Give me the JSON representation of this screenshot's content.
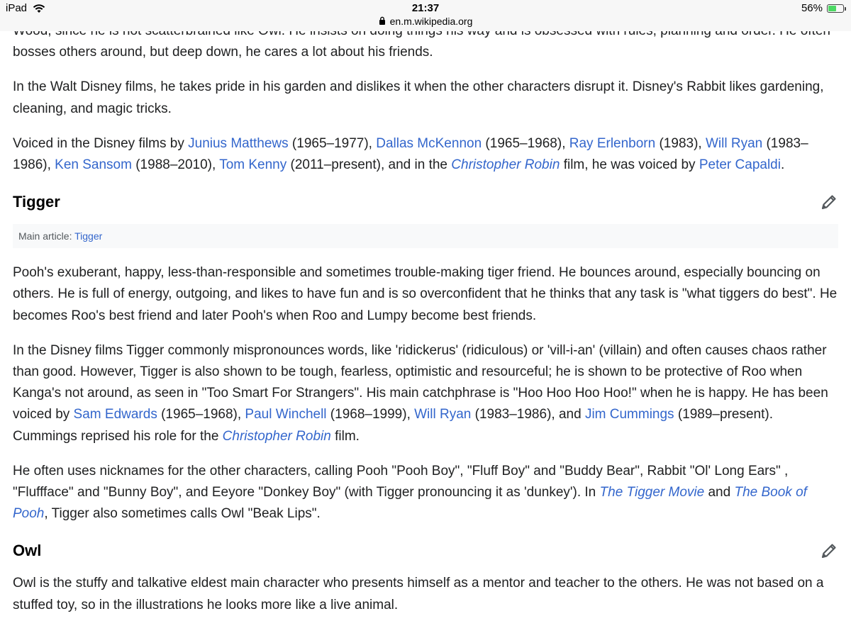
{
  "status_bar": {
    "device": "iPad",
    "time": "21:37",
    "url": "en.m.wikipedia.org",
    "battery_text": "56%",
    "battery_level": 0.56
  },
  "rabbit": {
    "p1_cut": "Wood, since he is not scatterbrained like Owl. He insists on doing things his way and is obsessed with rules, planning and order. He often",
    "p1": "bosses others around, but deep down, he cares a lot about his friends.",
    "p2": "In the Walt Disney films, he takes pride in his garden and dislikes it when the other characters disrupt it. Disney's Rabbit likes gardening, cleaning, and magic tricks.",
    "p3": {
      "t1": "Voiced in the Disney films by ",
      "l1": "Junius Matthews",
      "t2": " (1965–1977), ",
      "l2": "Dallas McKennon",
      "t3": " (1965–1968), ",
      "l3": "Ray Erlenborn",
      "t4": " (1983), ",
      "l4": "Will Ryan",
      "t5": " (1983–1986), ",
      "l5": "Ken Sansom",
      "t6": " (1988–2010), ",
      "l6": "Tom Kenny",
      "t7": " (2011–present), and in the ",
      "l7": "Christopher Robin",
      "t8": " film, he was voiced by ",
      "l8": "Peter Capaldi",
      "t9": "."
    }
  },
  "tigger": {
    "heading": "Tigger",
    "hatnote_label": "Main article: ",
    "hatnote_link": "Tigger",
    "p1": "Pooh's exuberant, happy, less-than-responsible and sometimes trouble-making tiger friend. He bounces around, especially bouncing on others. He is full of energy, outgoing, and likes to have fun and is so overconfident that he thinks that any task is \"what tiggers do best\". He becomes Roo's best friend and later Pooh's when Roo and Lumpy become best friends.",
    "p2": {
      "t1": "In the Disney films Tigger commonly mispronounces words, like 'ridickerus' (ridiculous) or 'vill-i-an' (villain) and often causes chaos rather than good. However, Tigger is also shown to be tough, fearless, optimistic and resourceful; he is shown to be protective of Roo when Kanga's not around, as seen in \"Too Smart For Strangers\". His main catchphrase is \"Hoo Hoo Hoo Hoo!\" when he is happy. He has been voiced by ",
      "l1": "Sam Edwards",
      "t2": " (1965–1968), ",
      "l2": "Paul Winchell",
      "t3": " (1968–1999), ",
      "l3": "Will Ryan",
      "t4": " (1983–1986), and ",
      "l4": "Jim Cummings",
      "t5": " (1989–present). Cummings reprised his role for the ",
      "l5": "Christopher Robin",
      "t6": " film."
    },
    "p3": {
      "t1": "He often uses nicknames for the other characters, calling Pooh \"Pooh Boy\", \"Fluff Boy\" and \"Buddy Bear\", Rabbit \"Ol' Long Ears\" , \"Fluffface\" and \"Bunny Boy\", and Eeyore \"Donkey Boy\" (with Tigger pronouncing it as 'dunkey'). In ",
      "l1": "The Tigger Movie",
      "t2": " and ",
      "l2": "The Book of Pooh",
      "t3": ", Tigger also sometimes calls Owl \"Beak Lips\"."
    }
  },
  "owl": {
    "heading": "Owl",
    "p1": "Owl is the stuffy and talkative eldest main character who presents himself as a mentor and teacher to the others. He was not based on a stuffed toy, so in the illustrations he looks more like a live animal."
  },
  "icons": {
    "edit": "pencil-icon",
    "lock": "lock-icon",
    "wifi": "wifi-icon",
    "battery": "battery-icon"
  },
  "colors": {
    "link": "#3366cc",
    "text": "#202122",
    "hatnote_bg": "#f8f9fa",
    "battery_fill": "#4cd964"
  }
}
